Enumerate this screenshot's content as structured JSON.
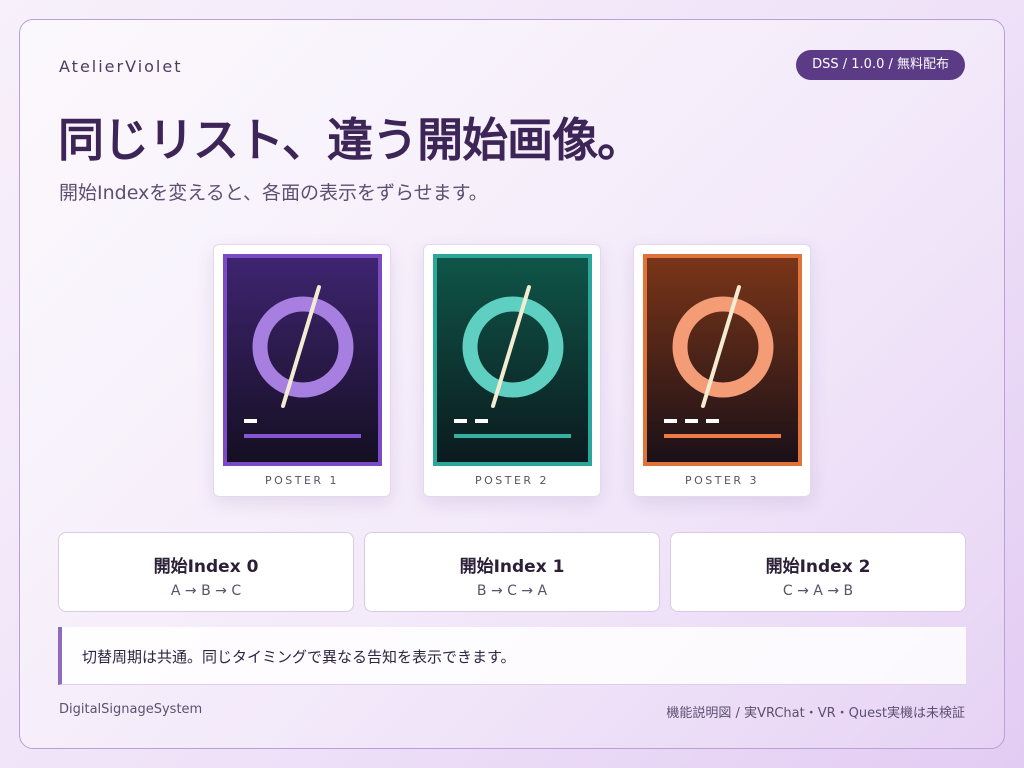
{
  "brand": "AtelierViolet",
  "version_badge": "DSS / 1.0.0 / 無料配布",
  "headline": "同じリスト、違う開始画像。",
  "subline": "開始Indexを変えると、各面の表示をずらせます。",
  "posters": [
    {
      "label": "POSTER 1",
      "dashes": 1,
      "colors": {
        "border": "#7a4bc4",
        "top": "#3f2470",
        "bottom": "#140f22",
        "ring": "#a77fe0",
        "bar": "#8756d4"
      }
    },
    {
      "label": "POSTER 2",
      "dashes": 2,
      "colors": {
        "border": "#2aa79a",
        "top": "#0f5548",
        "bottom": "#0b1a1e",
        "ring": "#5ecfc1",
        "bar": "#35b0a2"
      }
    },
    {
      "label": "POSTER 3",
      "dashes": 3,
      "colors": {
        "border": "#e0733a",
        "top": "#7a3518",
        "bottom": "#1a1018",
        "ring": "#f39c75",
        "bar": "#ec7b47"
      }
    }
  ],
  "index_cards": [
    {
      "title": "開始Index 0",
      "sequence": "A → B → C"
    },
    {
      "title": "開始Index 1",
      "sequence": "B → C → A"
    },
    {
      "title": "開始Index 2",
      "sequence": "C → A → B"
    }
  ],
  "note": "切替周期は共通。同じタイミングで異なる告知を表示できます。",
  "footer": {
    "left": "DigitalSignageSystem",
    "right": "機能説明図 / 実VRChat・VR・Quest実機は未検証"
  }
}
